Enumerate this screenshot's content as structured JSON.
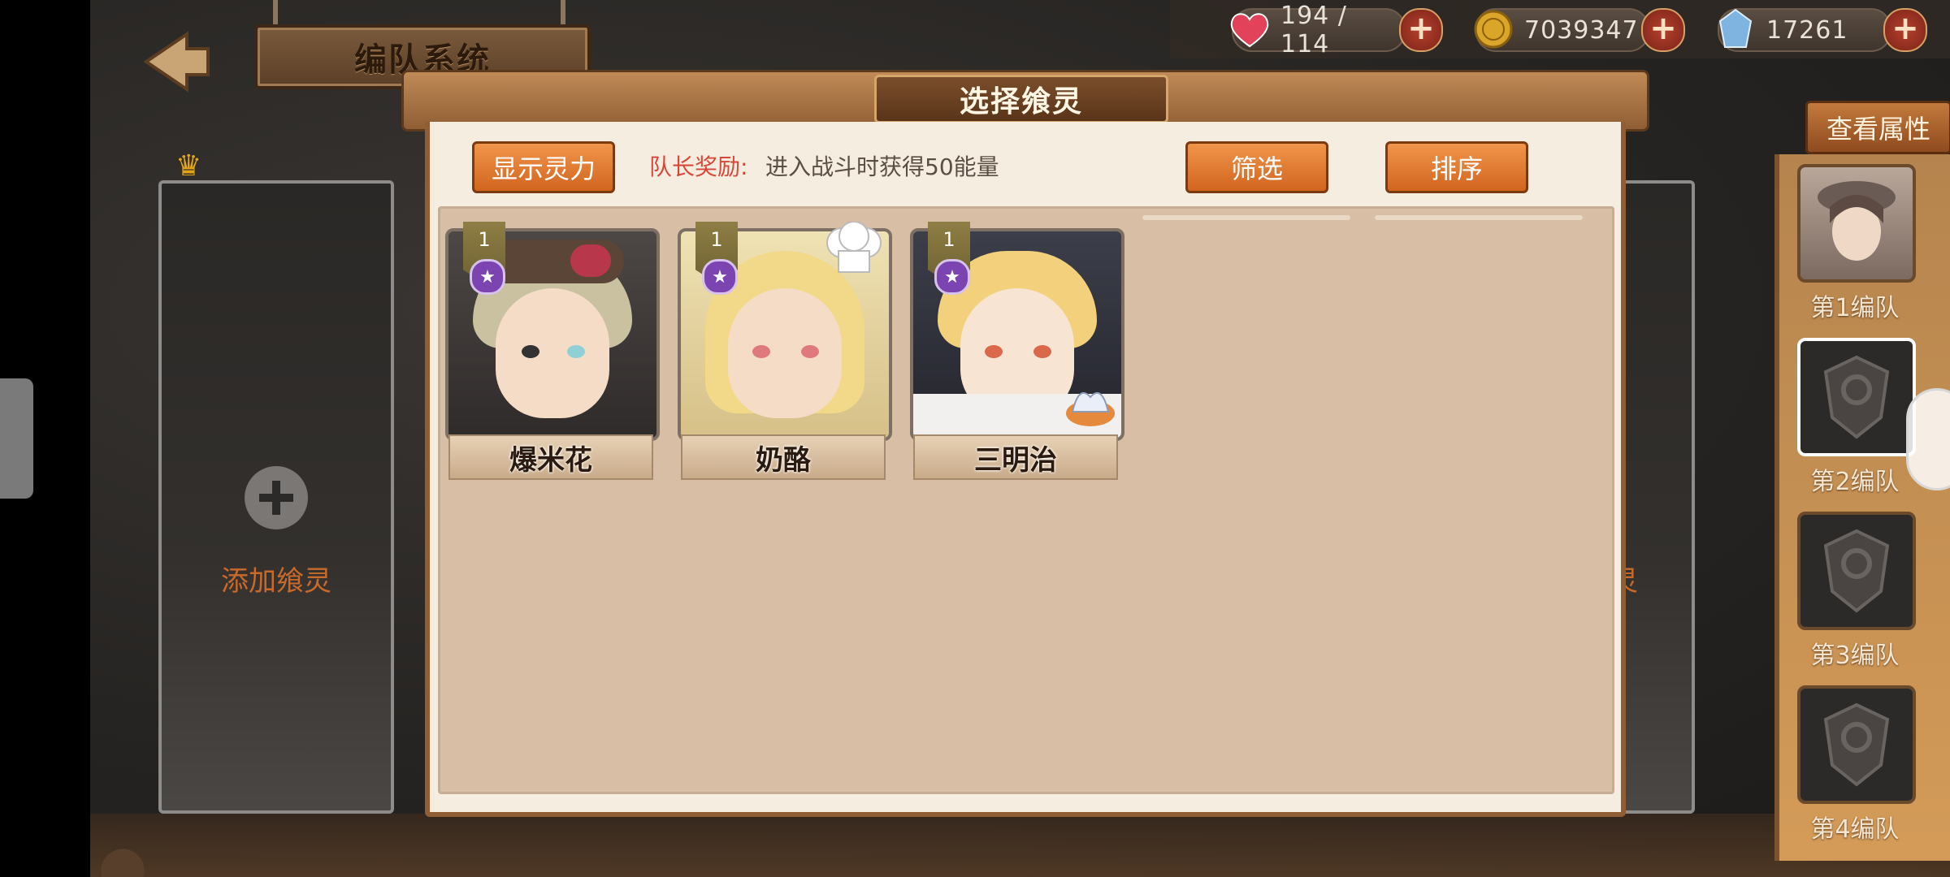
{
  "header": {
    "back_icon": "back-arrow-icon",
    "title": "编队系统"
  },
  "resources": {
    "stamina": {
      "icon": "heart-icon",
      "value": "194 / 114"
    },
    "gold": {
      "icon": "gold-coin-icon",
      "value": "7039347"
    },
    "crystal": {
      "icon": "crystal-icon",
      "value": "17261"
    },
    "add_label": "+"
  },
  "left_slot": {
    "add_label": "添加飨灵",
    "crown_icon": "crown-icon"
  },
  "right_slot": {
    "partial_label": "灵"
  },
  "sidebar": {
    "view_attributes": "查看属性",
    "teams": [
      {
        "label": "第1编队"
      },
      {
        "label": "第2编队"
      },
      {
        "label": "第3编队"
      },
      {
        "label": "第4编队"
      }
    ]
  },
  "modal": {
    "title": "选择飨灵",
    "show_power_button": "显示灵力",
    "leader_bonus_label": "队长奖励:",
    "leader_bonus_desc": "进入战斗时获得50能量",
    "filter_button": "筛选",
    "sort_button": "排序",
    "cards": [
      {
        "name": "爆米花",
        "level": "1",
        "hair_color": "#c9c1a0",
        "eye_color": "#8fd0d6"
      },
      {
        "name": "奶酪",
        "level": "1",
        "hair_color": "#f2d98a",
        "eye_color": "#e0797e"
      },
      {
        "name": "三明治",
        "level": "1",
        "hair_color": "#f3d17c",
        "eye_color": "#d9694a"
      }
    ]
  }
}
